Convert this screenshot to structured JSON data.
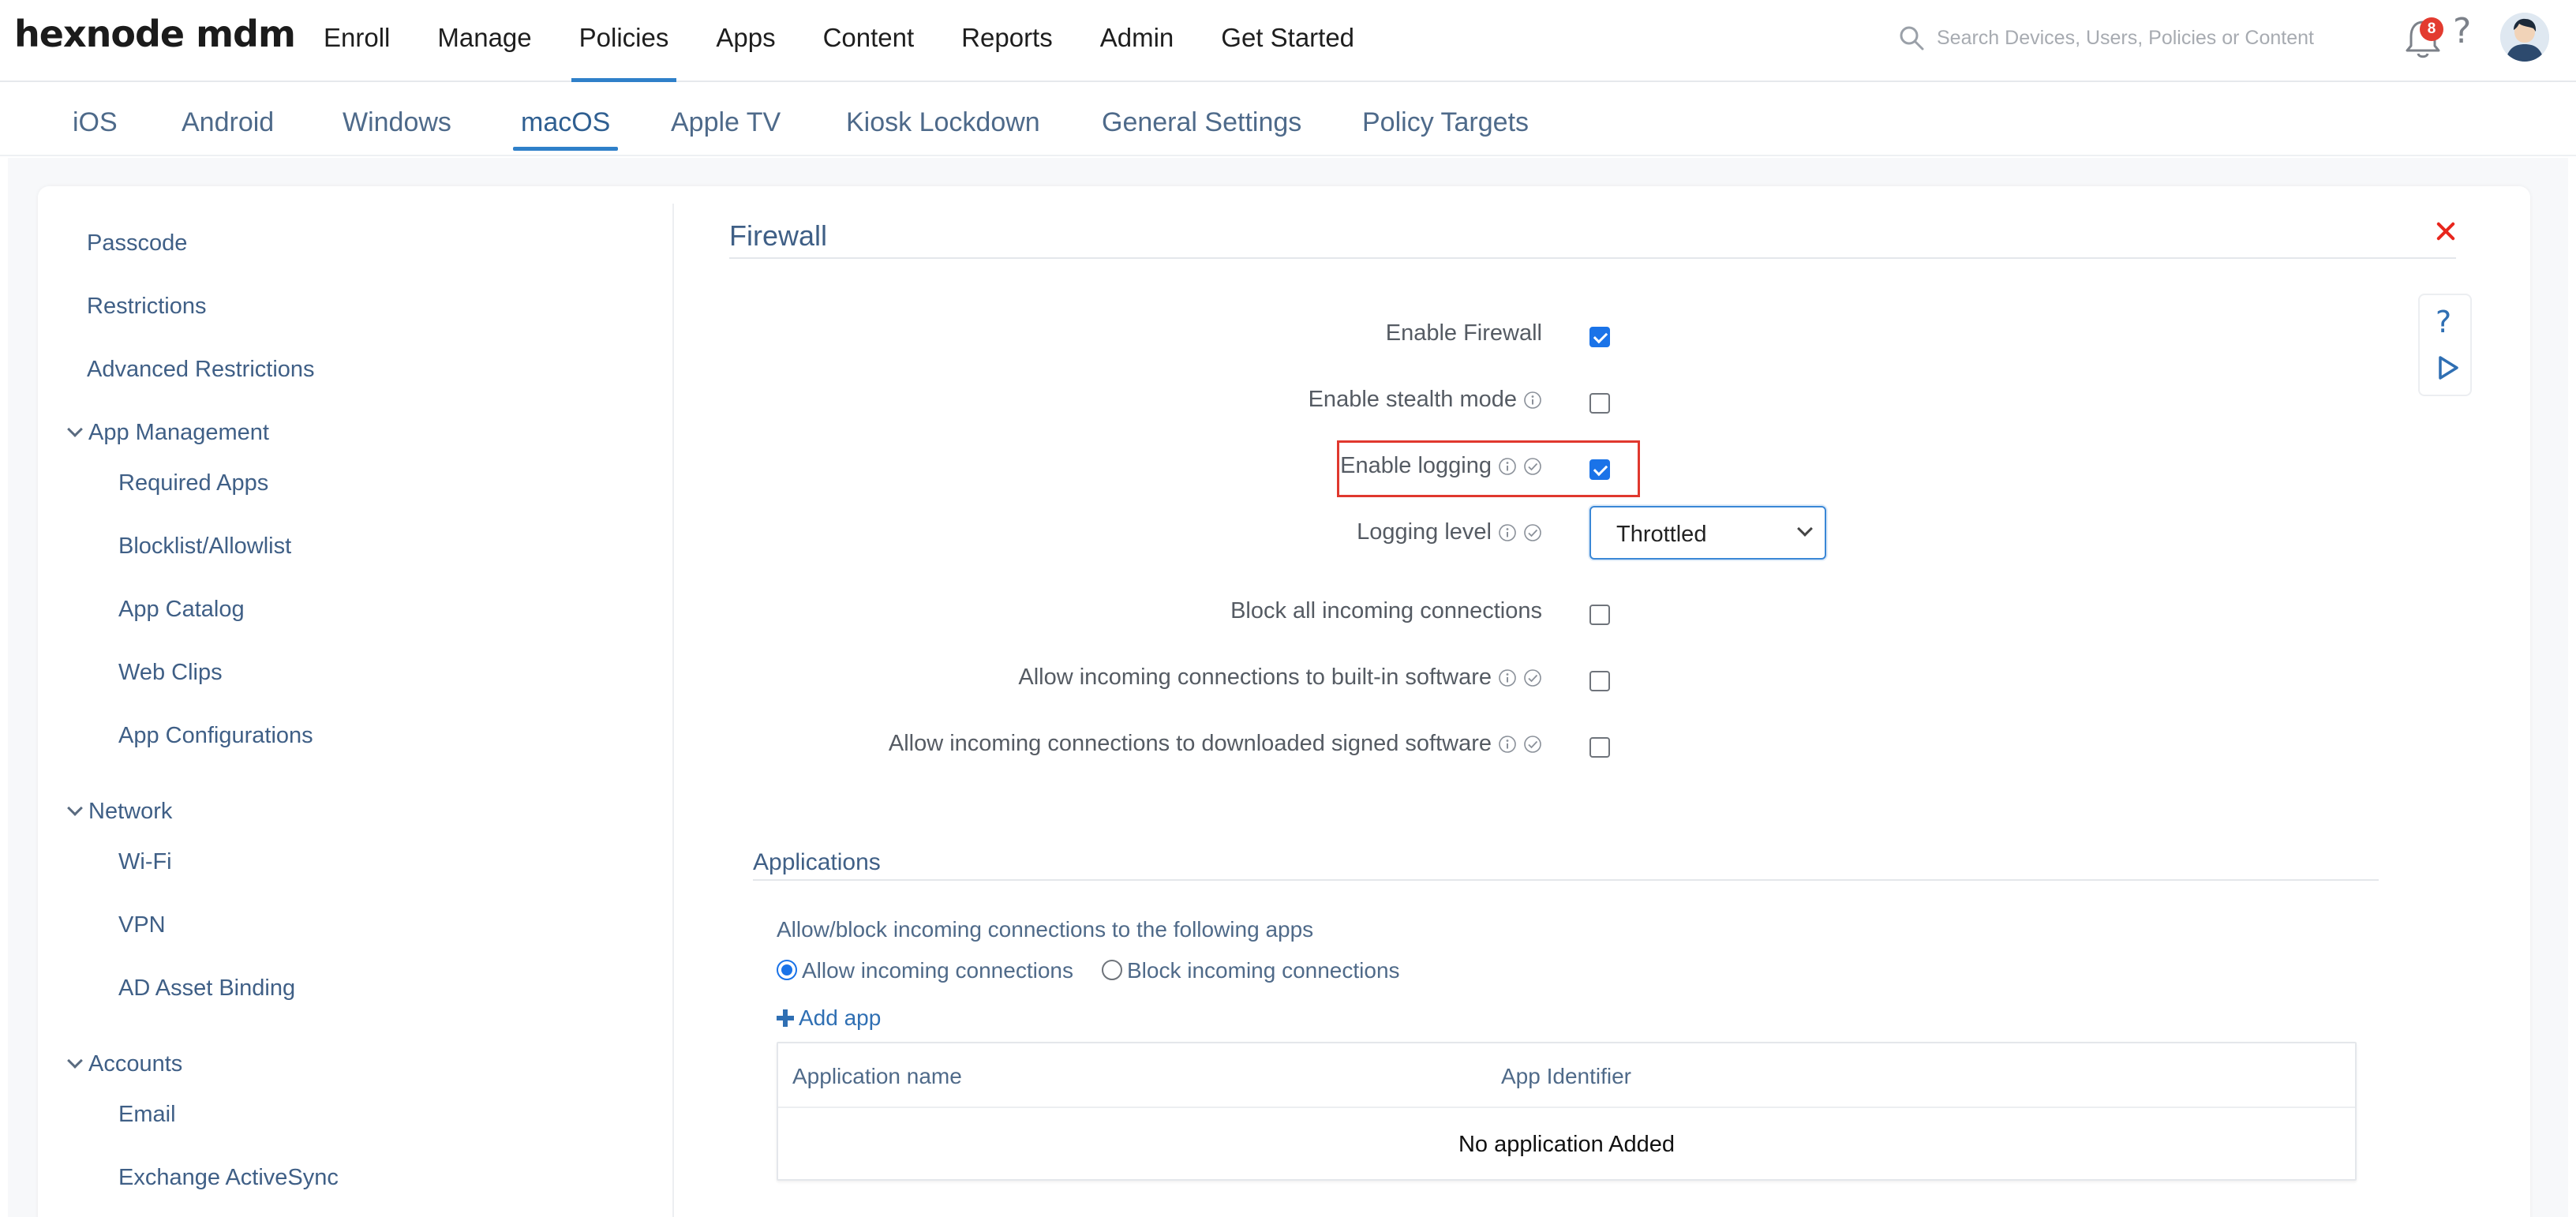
{
  "brand": {
    "logo_text": "hexnode mdm"
  },
  "main_nav": [
    {
      "label": "Enroll"
    },
    {
      "label": "Manage"
    },
    {
      "label": "Policies",
      "active": true
    },
    {
      "label": "Apps"
    },
    {
      "label": "Content"
    },
    {
      "label": "Reports"
    },
    {
      "label": "Admin"
    },
    {
      "label": "Get Started"
    }
  ],
  "search": {
    "placeholder": "Search Devices, Users, Policies or Content",
    "icon": "search-icon"
  },
  "header_icons": {
    "notifications_count": "8",
    "help": "?"
  },
  "os_tabs": [
    {
      "label": "iOS"
    },
    {
      "label": "Android"
    },
    {
      "label": "Windows"
    },
    {
      "label": "macOS",
      "active": true
    },
    {
      "label": "Apple TV"
    },
    {
      "label": "Kiosk Lockdown"
    },
    {
      "label": "General Settings"
    },
    {
      "label": "Policy Targets"
    }
  ],
  "sidebar": {
    "top_items": [
      "Passcode",
      "Restrictions",
      "Advanced Restrictions"
    ],
    "groups": [
      {
        "label": "App Management",
        "items": [
          "Required Apps",
          "Blocklist/Allowlist",
          "App Catalog",
          "Web Clips",
          "App Configurations"
        ]
      },
      {
        "label": "Network",
        "items": [
          "Wi-Fi",
          "VPN",
          "AD Asset Binding"
        ]
      },
      {
        "label": "Accounts",
        "items": [
          "Email",
          "Exchange ActiveSync"
        ]
      }
    ]
  },
  "firewall": {
    "title": "Firewall",
    "settings": [
      {
        "label": "Enable Firewall",
        "checked": true,
        "info": false,
        "verified": false
      },
      {
        "label": "Enable stealth mode",
        "checked": false,
        "info": true,
        "verified": false
      },
      {
        "label": "Enable logging",
        "checked": true,
        "info": true,
        "verified": true,
        "highlighted": true
      },
      {
        "label": "Logging level",
        "type": "select",
        "value": "Throttled",
        "info": true,
        "verified": true
      },
      {
        "label": "Block all incoming connections",
        "checked": false,
        "info": false,
        "verified": false
      },
      {
        "label": "Allow incoming connections to built-in software",
        "checked": false,
        "info": true,
        "verified": true
      },
      {
        "label": "Allow incoming connections to downloaded signed software",
        "checked": false,
        "info": true,
        "verified": true
      }
    ]
  },
  "applications": {
    "title": "Applications",
    "description": "Allow/block incoming connections to the following apps",
    "radio_options": [
      {
        "label": "Allow incoming connections",
        "selected": true
      },
      {
        "label": "Block incoming connections",
        "selected": false
      }
    ],
    "add_label": "Add app",
    "table": {
      "columns": [
        "Application name",
        "App Identifier"
      ],
      "empty_text": "No application Added"
    }
  },
  "colors": {
    "accent": "#2f80c9",
    "link": "#3f5f86",
    "highlight": "#e0382e",
    "checkbox": "#1a73e8",
    "close": "#e8261d"
  }
}
